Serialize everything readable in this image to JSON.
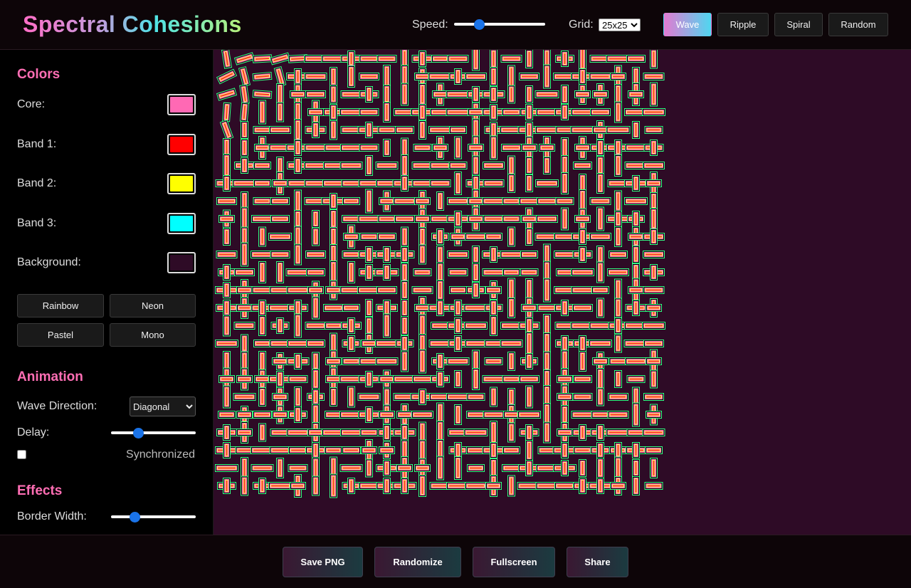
{
  "header": {
    "title": "Spectral Cohesions",
    "speed_label": "Speed:",
    "speed_value": 25,
    "grid_label": "Grid:",
    "grid_selected": "25x25",
    "modes": [
      {
        "label": "Wave",
        "active": true
      },
      {
        "label": "Ripple",
        "active": false
      },
      {
        "label": "Spiral",
        "active": false
      },
      {
        "label": "Random",
        "active": false
      }
    ]
  },
  "sidebar": {
    "colors_title": "Colors",
    "colors": [
      {
        "label": "Core:",
        "value": "#ff69b4"
      },
      {
        "label": "Band 1:",
        "value": "#ff0000"
      },
      {
        "label": "Band 2:",
        "value": "#ffff00"
      },
      {
        "label": "Band 3:",
        "value": "#00ffff"
      },
      {
        "label": "Background:",
        "value": "#2e0b26"
      }
    ],
    "presets": [
      "Rainbow",
      "Neon",
      "Pastel",
      "Mono"
    ],
    "animation_title": "Animation",
    "wave_direction_label": "Wave Direction:",
    "wave_direction_selected": "Diagonal",
    "delay_label": "Delay:",
    "delay_value": 30,
    "synchronized_label": "Synchronized",
    "synchronized_checked": false,
    "effects_title": "Effects",
    "border_width_label": "Border Width:",
    "border_width_value": 25
  },
  "canvas": {
    "grid_size": 25,
    "background": "#2e0b26",
    "outline_color": "#000000",
    "glow_color": "#39ff88",
    "band_outer": "#ff69b4",
    "band_mid": "#ffff66",
    "band_core": "#ff2d2d"
  },
  "footer": {
    "buttons": [
      "Save PNG",
      "Randomize",
      "Fullscreen",
      "Share"
    ]
  },
  "icons": {
    "speed-slider": "range-slider",
    "delay-slider": "range-slider",
    "border-width-slider": "range-slider"
  }
}
